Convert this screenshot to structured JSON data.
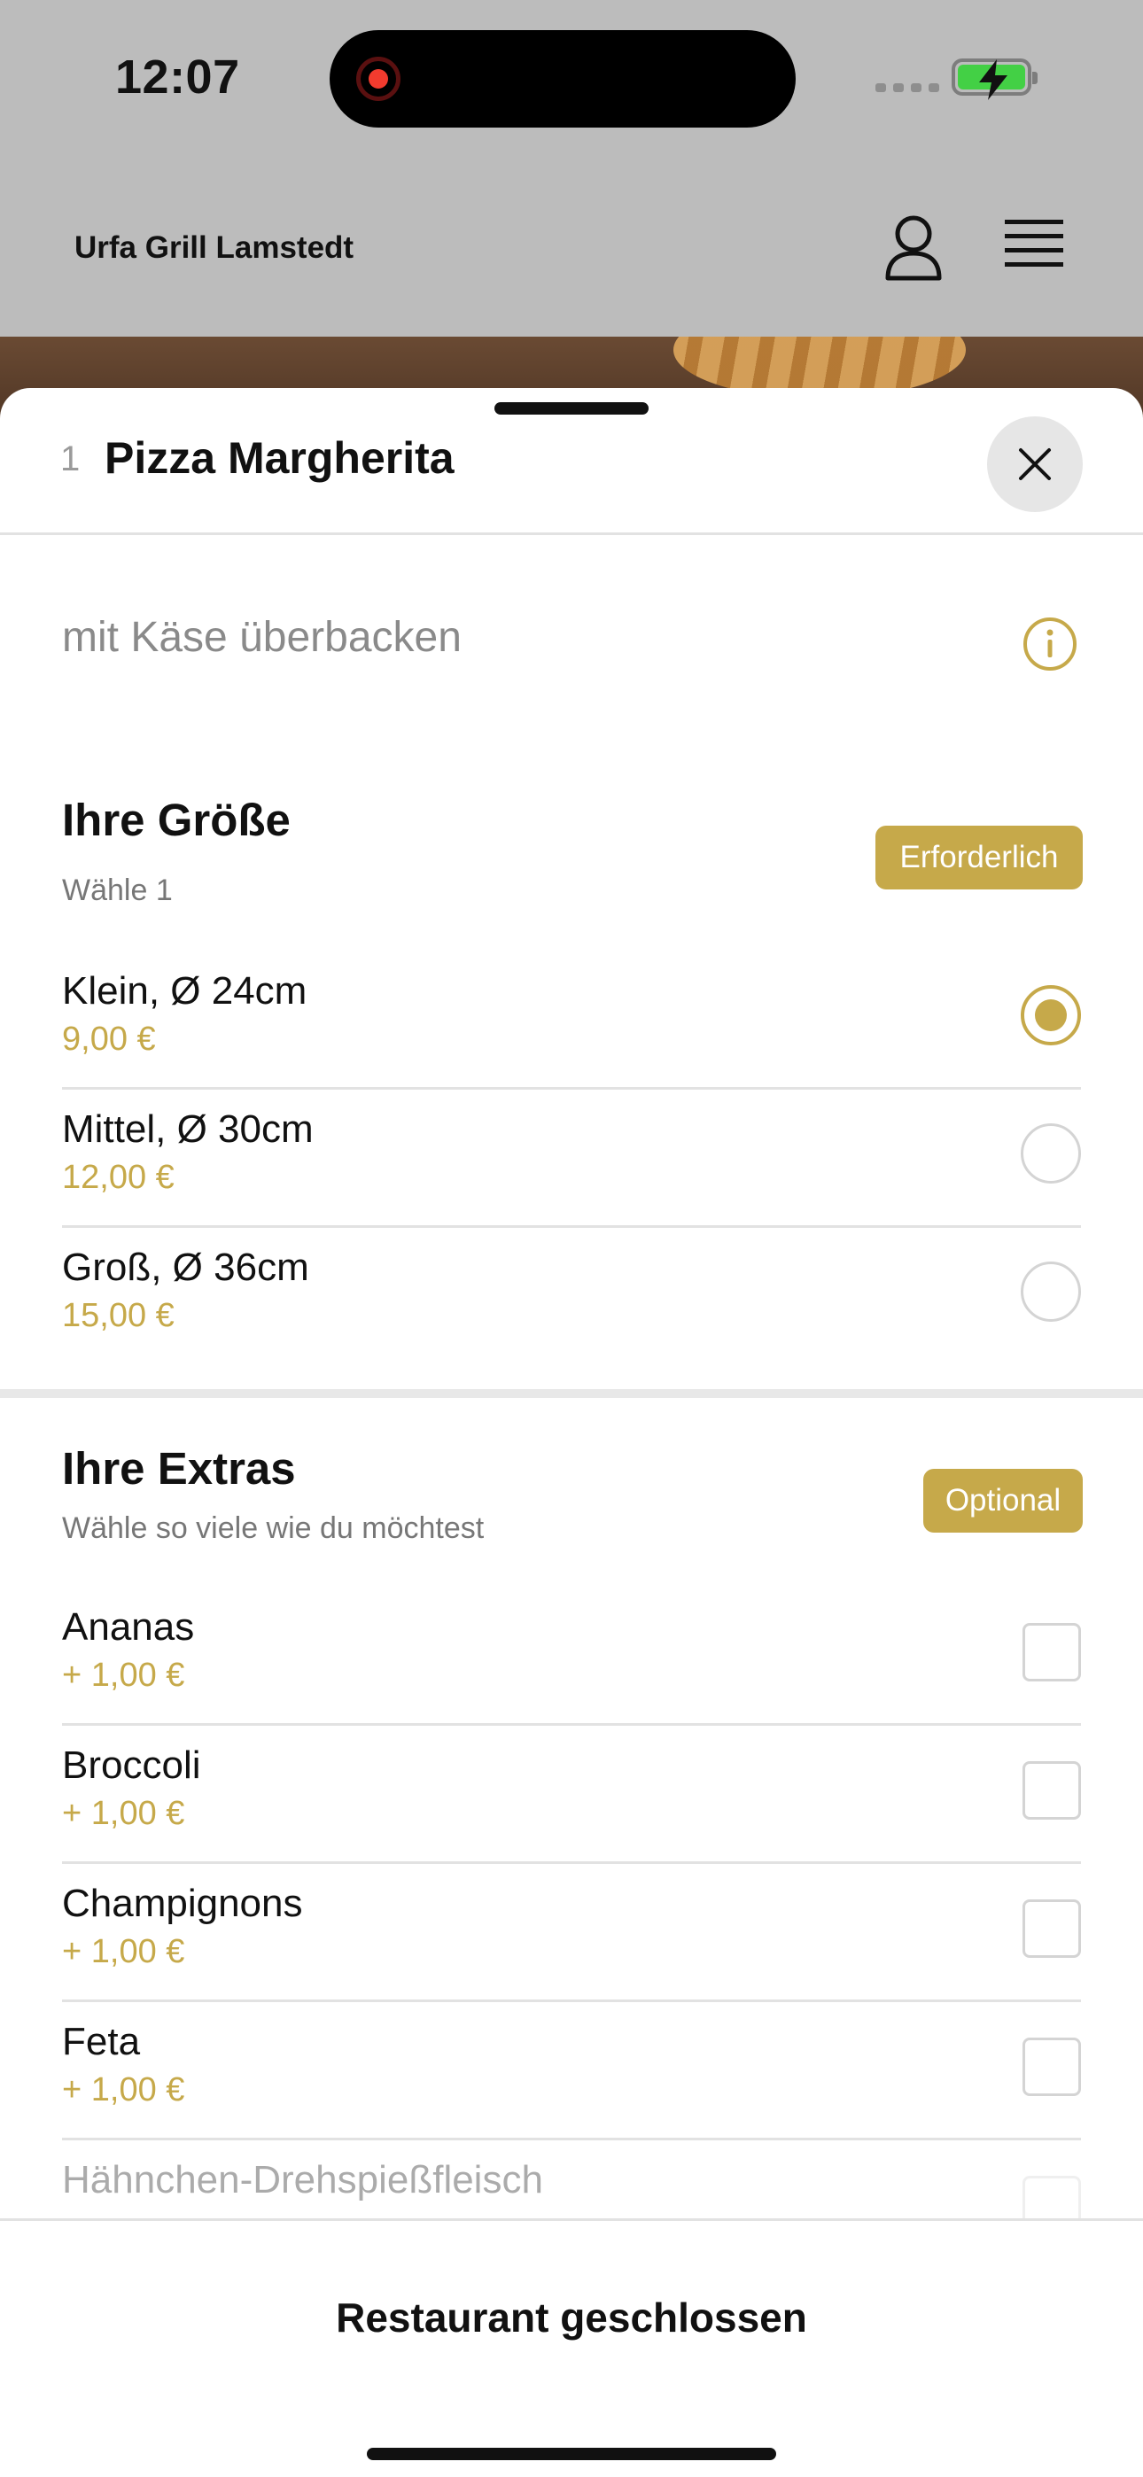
{
  "status_bar": {
    "time": "12:07"
  },
  "header": {
    "restaurant_name": "Urfa Grill Lamstedt",
    "icons": [
      "user-icon",
      "menu-icon"
    ]
  },
  "item": {
    "quantity": "1",
    "title": "Pizza Margherita",
    "description": "mit Käse überbacken"
  },
  "size_section": {
    "title": "Ihre Größe",
    "subtitle": "Wähle 1",
    "badge": "Erforderlich",
    "options": [
      {
        "label": "Klein, Ø 24cm",
        "price": "9,00 €",
        "selected": true
      },
      {
        "label": "Mittel, Ø 30cm",
        "price": "12,00 €",
        "selected": false
      },
      {
        "label": "Groß, Ø 36cm",
        "price": "15,00 €",
        "selected": false
      }
    ]
  },
  "extras_section": {
    "title": "Ihre Extras",
    "subtitle": "Wähle so viele wie du möchtest",
    "badge": "Optional",
    "options": [
      {
        "label": "Ananas",
        "price": "+ 1,00 €",
        "checked": false
      },
      {
        "label": "Broccoli",
        "price": "+ 1,00 €",
        "checked": false
      },
      {
        "label": "Champignons",
        "price": "+ 1,00 €",
        "checked": false
      },
      {
        "label": "Feta",
        "price": "+ 1,00 €",
        "checked": false
      },
      {
        "label": "Hähnchen-Drehspießfleisch",
        "checked": false
      }
    ]
  },
  "footer": {
    "status_label": "Restaurant geschlossen"
  },
  "colors": {
    "accent": "#c6a94a",
    "header_bg": "#bcbcbc",
    "battery": "#43d045",
    "record": "#f23b2e"
  }
}
